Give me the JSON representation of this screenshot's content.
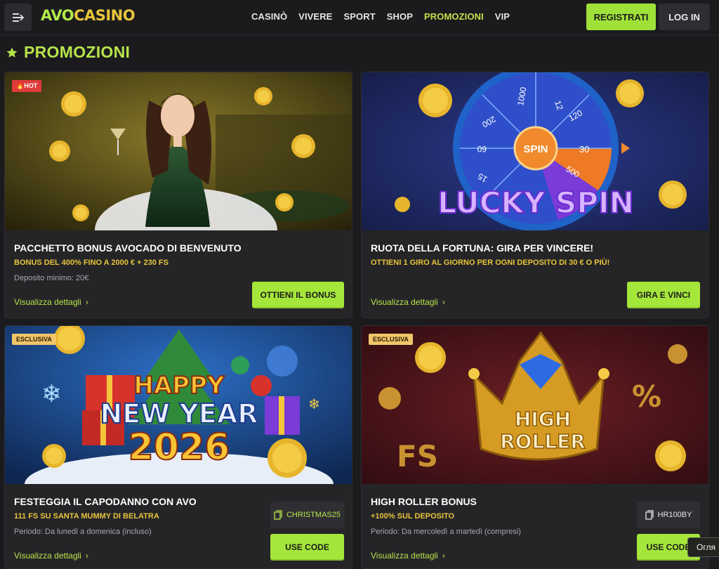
{
  "header": {
    "logo_part1": "AVO",
    "logo_part2": "CASINO",
    "nav": [
      "CASINÒ",
      "VIVERE",
      "SPORT",
      "SHOP",
      "PROMOZIONI",
      "VIP"
    ],
    "register_label": "REGISTRATI",
    "login_label": "LOG IN"
  },
  "page": {
    "title": "PROMOZIONI"
  },
  "cards": [
    {
      "badge": "HOT",
      "title": "PACCHETTO BONUS AVOCADO DI BENVENUTO",
      "subtitle": "BONUS DEL 400% FINO A 2000 € + 230 FS",
      "info": "Deposito minimo: 20€",
      "details": "Visualizza dettagli",
      "cta": "OTTIENI IL BONUS"
    },
    {
      "title": "RUOTA DELLA FORTUNA: GIRA PER VINCERE!",
      "subtitle": "OTTIENI 1 GIRO AL GIORNO PER OGNI DEPOSITO DI 30 € O PIÙ!",
      "details": "Visualizza dettagli",
      "cta": "GIRA E VINCI",
      "banner_text": "LUCKY SPIN",
      "wheel_center": "SPIN",
      "wheel_values": [
        "1000",
        "12",
        "120",
        "30",
        "500",
        "15",
        "60",
        "200"
      ]
    },
    {
      "badge": "ESCLUSIVA",
      "title": "FESTEGGIA IL CAPODANNO CON AVO",
      "subtitle": "111 FS SU SANTA MUMMY DI BELATRA",
      "info": "Periodo: Da lunedì a domenica (incluso)",
      "details": "Visualizza dettagli",
      "code": "CHRISTMAS25",
      "cta": "USE CODE",
      "banner_line1": "HAPPY",
      "banner_line2": "NEW YEAR",
      "banner_line3": "2026"
    },
    {
      "badge": "ESCLUSIVA",
      "title": "HIGH ROLLER BONUS",
      "subtitle": "+100% SUL DEPOSITO",
      "info": "Periodo: Da mercoledì a martedì (compresi)",
      "details": "Visualizza dettagli",
      "code": "HR100BY",
      "cta": "USE CODE",
      "banner_line1": "HIGH",
      "banner_line2": "ROLLER"
    }
  ],
  "tooltip": "Огля",
  "colors": {
    "accent_green": "#a5e63a",
    "accent_yellow": "#e8c43a",
    "background": "#1b1b1e",
    "card": "#252528"
  }
}
